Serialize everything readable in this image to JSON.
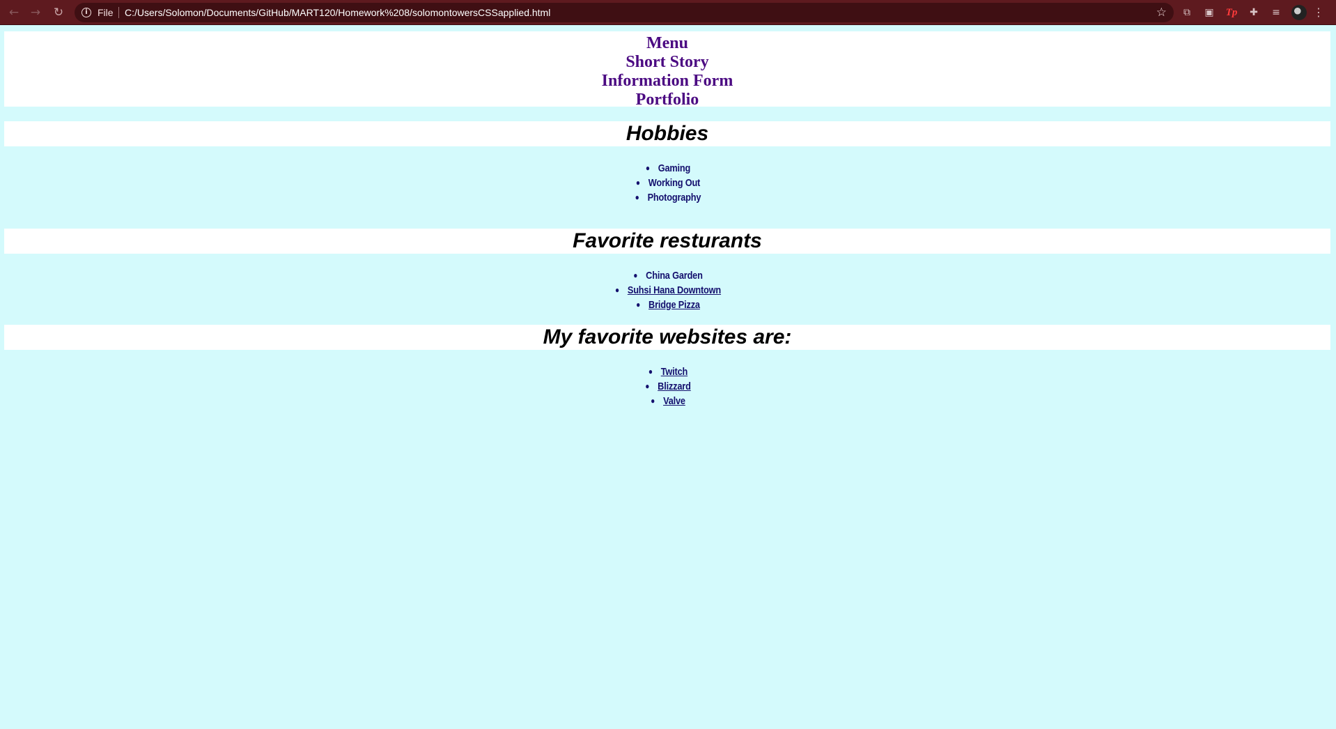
{
  "browser": {
    "back_icon": "←",
    "forward_icon": "→",
    "reload_icon": "↻",
    "info_icon": "i",
    "file_label": "File",
    "url": "C:/Users/Solomon/Documents/GitHub/MART120/Homework%208/solomontowersCSSapplied.html",
    "star_icon": "☆",
    "menu_icon": "⋮",
    "extensions": [
      {
        "name": "extension-1-icon",
        "glyph": "⧉"
      },
      {
        "name": "extension-2-icon",
        "glyph": "▣"
      },
      {
        "name": "tp-extension-icon",
        "glyph": "Tp"
      },
      {
        "name": "puzzle-icon",
        "glyph": "✚"
      },
      {
        "name": "reading-list-icon",
        "glyph": "≡"
      }
    ]
  },
  "nav": {
    "menu": "Menu",
    "short_story": "Short Story",
    "information_form": "Information Form",
    "portfolio": "Portfolio"
  },
  "sections": {
    "hobbies": {
      "title": "Hobbies",
      "items": [
        "Gaming",
        "Working Out",
        "Photography"
      ]
    },
    "restaurants": {
      "title": "Favorite resturants",
      "items": [
        "China Garden",
        "Suhsi Hana Downtown",
        "Bridge Pizza"
      ]
    },
    "websites": {
      "title": "My favorite websites are:",
      "items": [
        "Twitch",
        "Blizzard",
        "Valve"
      ]
    }
  },
  "colors": {
    "page_background": "#d4fafc",
    "nav_link": "#4b0a82",
    "list_text": "#14106e",
    "toolbar": "#5e1a1f"
  }
}
